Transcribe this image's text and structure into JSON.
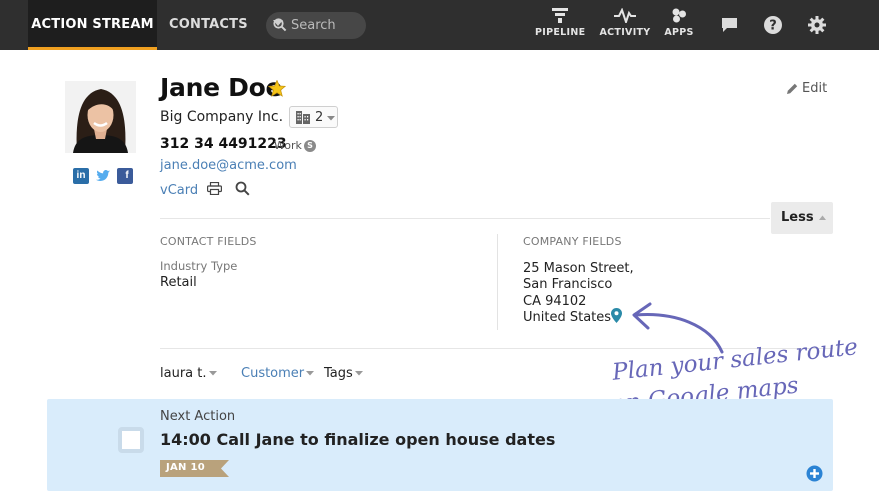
{
  "nav": {
    "tabs": [
      {
        "label": "ACTION STREAM",
        "active": true
      },
      {
        "label": "CONTACTS",
        "active": false
      }
    ],
    "search_placeholder": "Search",
    "buttons": [
      {
        "label": "PIPELINE",
        "icon": "funnel-icon"
      },
      {
        "label": "ACTIVITY",
        "icon": "pulse-icon"
      },
      {
        "label": "APPS",
        "icon": "apps-icon"
      }
    ],
    "icons": [
      "chat-icon",
      "help-icon",
      "gear-icon"
    ]
  },
  "contact": {
    "name": "Jane Doe",
    "starred": true,
    "company": "Big Company Inc.",
    "company_count": "2",
    "phone": "312 34 4491223",
    "phone_type": "Work",
    "email": "jane.doe@acme.com",
    "vcard_label": "vCard",
    "edit_label": "Edit",
    "less_label": "Less"
  },
  "contact_fields": {
    "section_label": "CONTACT FIELDS",
    "industry_label": "Industry Type",
    "industry_value": "Retail"
  },
  "company_fields": {
    "section_label": "COMPANY FIELDS",
    "address_lines": [
      "25 Mason Street,",
      "San Francisco",
      "CA 94102",
      "United States"
    ]
  },
  "owner_row": {
    "owner": "laura t.",
    "status": "Customer",
    "tags_label": "Tags"
  },
  "next_action": {
    "label": "Next Action",
    "title": "14:00 Call Jane to finalize open house dates",
    "date": "JAN 10"
  },
  "annotation": {
    "line1": "Plan your sales route",
    "line2": "on Google maps"
  },
  "colors": {
    "accent": "#f0a020",
    "link": "#4a7fb5",
    "action_bg": "#d9ecfb",
    "annotation": "#6767b8"
  }
}
